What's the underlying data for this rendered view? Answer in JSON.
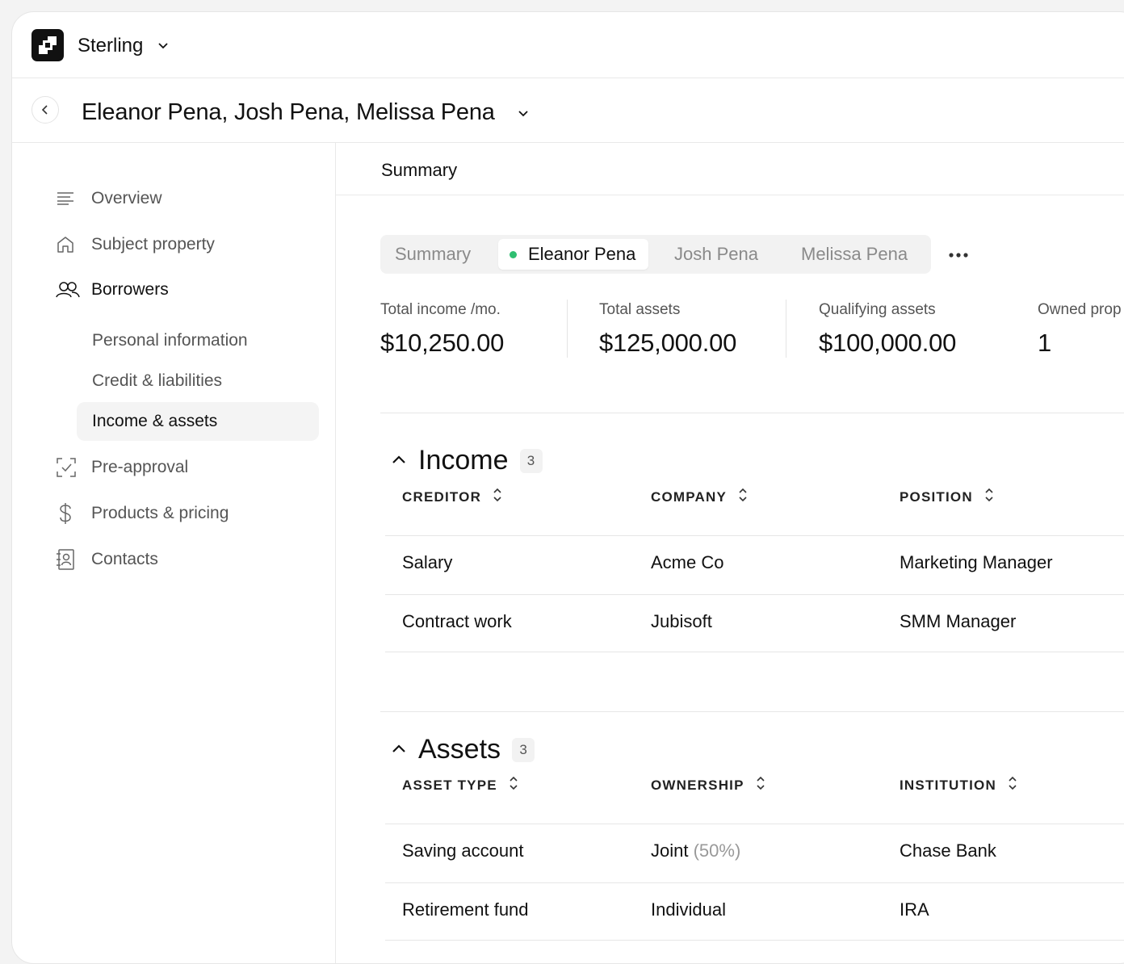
{
  "app": {
    "brand": "Sterling"
  },
  "header": {
    "title": "Eleanor Pena, Josh Pena, Melissa Pena"
  },
  "sidebar": {
    "items": [
      {
        "label": "Overview",
        "icon": "lines-icon"
      },
      {
        "label": "Subject property",
        "icon": "home-icon"
      },
      {
        "label": "Borrowers",
        "icon": "users-icon"
      },
      {
        "label": "Pre-approval",
        "icon": "checkbox-scan-icon"
      },
      {
        "label": "Products & pricing",
        "icon": "dollar-icon"
      },
      {
        "label": "Contacts",
        "icon": "contact-book-icon"
      }
    ],
    "borrower_subitems": [
      {
        "label": "Personal information"
      },
      {
        "label": "Credit & liabilities"
      },
      {
        "label": "Income & assets",
        "active": true
      }
    ]
  },
  "main": {
    "section_title": "Summary",
    "tabs": [
      {
        "label": "Summary"
      },
      {
        "label": "Eleanor Pena",
        "active": true,
        "status_color": "#2fbf71"
      },
      {
        "label": "Josh Pena"
      },
      {
        "label": "Melissa Pena"
      }
    ],
    "stats": [
      {
        "label": "Total income /mo.",
        "value": "$10,250.00"
      },
      {
        "label": "Total assets",
        "value": "$125,000.00"
      },
      {
        "label": "Qualifying assets",
        "value": "$100,000.00"
      },
      {
        "label": "Owned prop",
        "value": "1"
      }
    ],
    "income": {
      "title": "Income",
      "count": "3",
      "columns": [
        "CREDITOR",
        "COMPANY",
        "POSITION"
      ],
      "rows": [
        [
          "Salary",
          "Acme Co",
          "Marketing Manager"
        ],
        [
          "Contract work",
          "Jubisoft",
          "SMM Manager"
        ]
      ]
    },
    "assets": {
      "title": "Assets",
      "count": "3",
      "columns": [
        "ASSET TYPE",
        "OWNERSHIP",
        "INSTITUTION"
      ],
      "rows": [
        {
          "type": "Saving account",
          "ownership": "Joint",
          "ownership_share": "(50%)",
          "institution": "Chase Bank"
        },
        {
          "type": "Retirement fund",
          "ownership": "Individual",
          "ownership_share": "",
          "institution": "IRA"
        }
      ]
    }
  }
}
